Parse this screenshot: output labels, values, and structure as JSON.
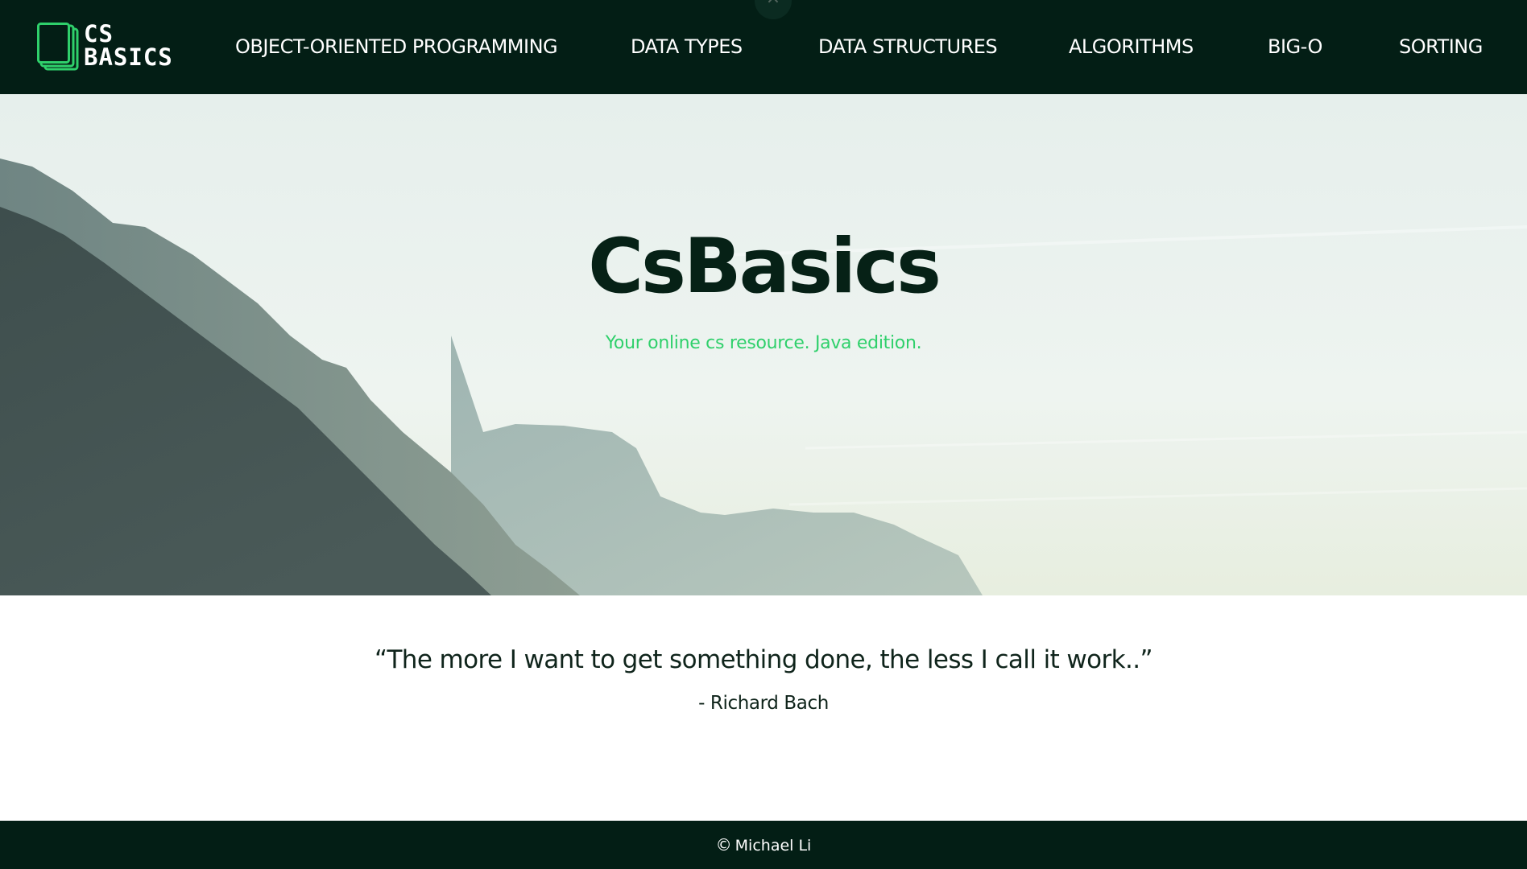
{
  "header": {
    "close_glyph": "×",
    "logo": {
      "line1": "CS",
      "line2": "BASICS"
    },
    "nav": [
      {
        "label": "OBJECT-ORIENTED PROGRAMMING"
      },
      {
        "label": "DATA TYPES"
      },
      {
        "label": "DATA STRUCTURES"
      },
      {
        "label": "ALGORITHMS"
      },
      {
        "label": "BIG-O"
      },
      {
        "label": "SORTING"
      }
    ]
  },
  "hero": {
    "title": "CsBasics",
    "subtitle": "Your online cs resource. Java edition."
  },
  "quote": {
    "text": "“The more I want to get something done, the less I call it work..”",
    "author": "- Richard Bach"
  },
  "footer": {
    "copyright_symbol": "©",
    "text": "Michael Li"
  },
  "colors": {
    "header_bg": "#031e15",
    "accent_green": "#2fd06b",
    "title_dark": "#062116",
    "logo_mark": "#2fd06b"
  },
  "icons": {
    "logo": "stacked-pages-logo-icon",
    "close": "close-icon",
    "copyright": "copyright-icon"
  }
}
